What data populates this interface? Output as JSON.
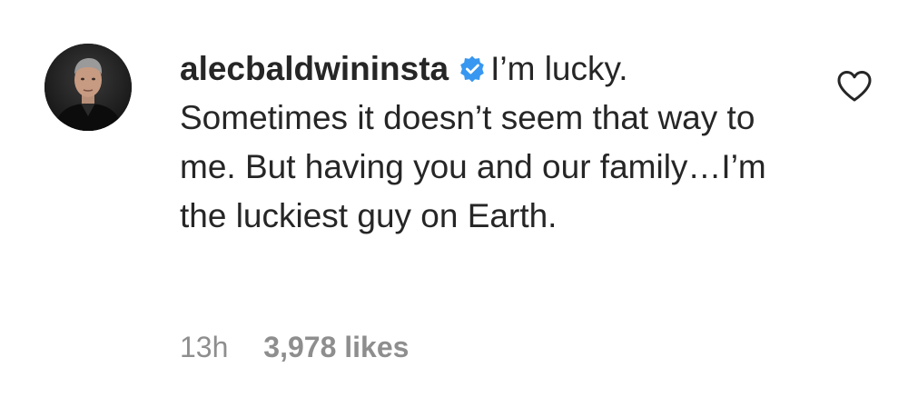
{
  "comment": {
    "username": "alecbaldwininsta",
    "verified_icon": "verified-badge-icon",
    "text": "I’m lucky. Sometimes it doesn’t seem that way to me. But having you and our family…I’m the luckiest guy on Earth.",
    "timestamp": "13h",
    "likes": "3,978 likes",
    "like_icon": "heart-outline-icon",
    "avatar_icon": "profile-photo",
    "accent_color": "#3897f0"
  }
}
